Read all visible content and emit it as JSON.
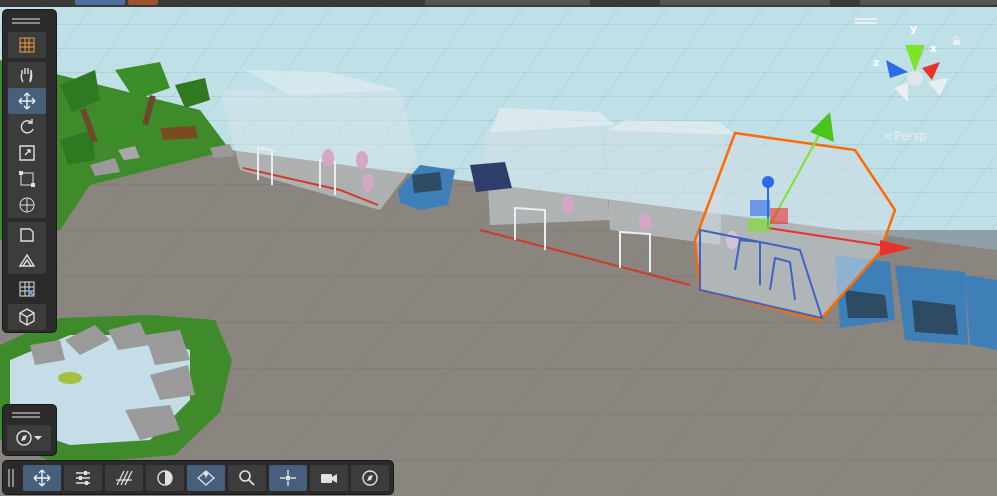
{
  "scene_view": {
    "projection_label": "Persp",
    "gizmo_axes": {
      "x": "x",
      "y": "y",
      "z": "z"
    }
  },
  "tools": [
    {
      "id": "grid",
      "icon": "grid-snap-icon",
      "active": false
    },
    {
      "id": "view",
      "icon": "hand-icon",
      "active": false
    },
    {
      "id": "move",
      "icon": "move-icon",
      "active": true
    },
    {
      "id": "rotate",
      "icon": "rotate-icon",
      "active": false
    },
    {
      "id": "scale",
      "icon": "scale-icon",
      "active": false
    },
    {
      "id": "rect",
      "icon": "rect-transform-icon",
      "active": false
    },
    {
      "id": "transform",
      "icon": "transform-icon",
      "active": false
    },
    {
      "id": "custom-editor",
      "icon": "custom-editor-icon",
      "active": false
    },
    {
      "id": "probuilder",
      "icon": "probuilder-icon",
      "active": false
    },
    {
      "id": "grid-toggle",
      "icon": "grid-toggle-icon",
      "active": false
    },
    {
      "id": "object-mode",
      "icon": "cube-icon",
      "active": false
    }
  ],
  "bottom_tools": [
    {
      "id": "move-tool",
      "icon": "move-icon",
      "active": true
    },
    {
      "id": "settings",
      "icon": "sliders-icon",
      "active": false
    },
    {
      "id": "grid-lines",
      "icon": "hatch-grid-icon",
      "active": false
    },
    {
      "id": "lighting",
      "icon": "lighting-icon",
      "active": false
    },
    {
      "id": "snap-plane",
      "icon": "snap-plane-icon",
      "active": true
    },
    {
      "id": "search",
      "icon": "search-icon",
      "active": false
    },
    {
      "id": "pivot",
      "icon": "pivot-icon",
      "active": true
    },
    {
      "id": "camera",
      "icon": "camera-icon",
      "active": false
    },
    {
      "id": "navigate",
      "icon": "compass-icon",
      "active": false
    }
  ],
  "colors": {
    "selection_outline": "#ff6a00",
    "axis_x": "#e8322b",
    "axis_y": "#7ee32a",
    "axis_z": "#2a6be8",
    "toolbar_bg": "#2b2b2b",
    "active_button": "#46607c"
  }
}
